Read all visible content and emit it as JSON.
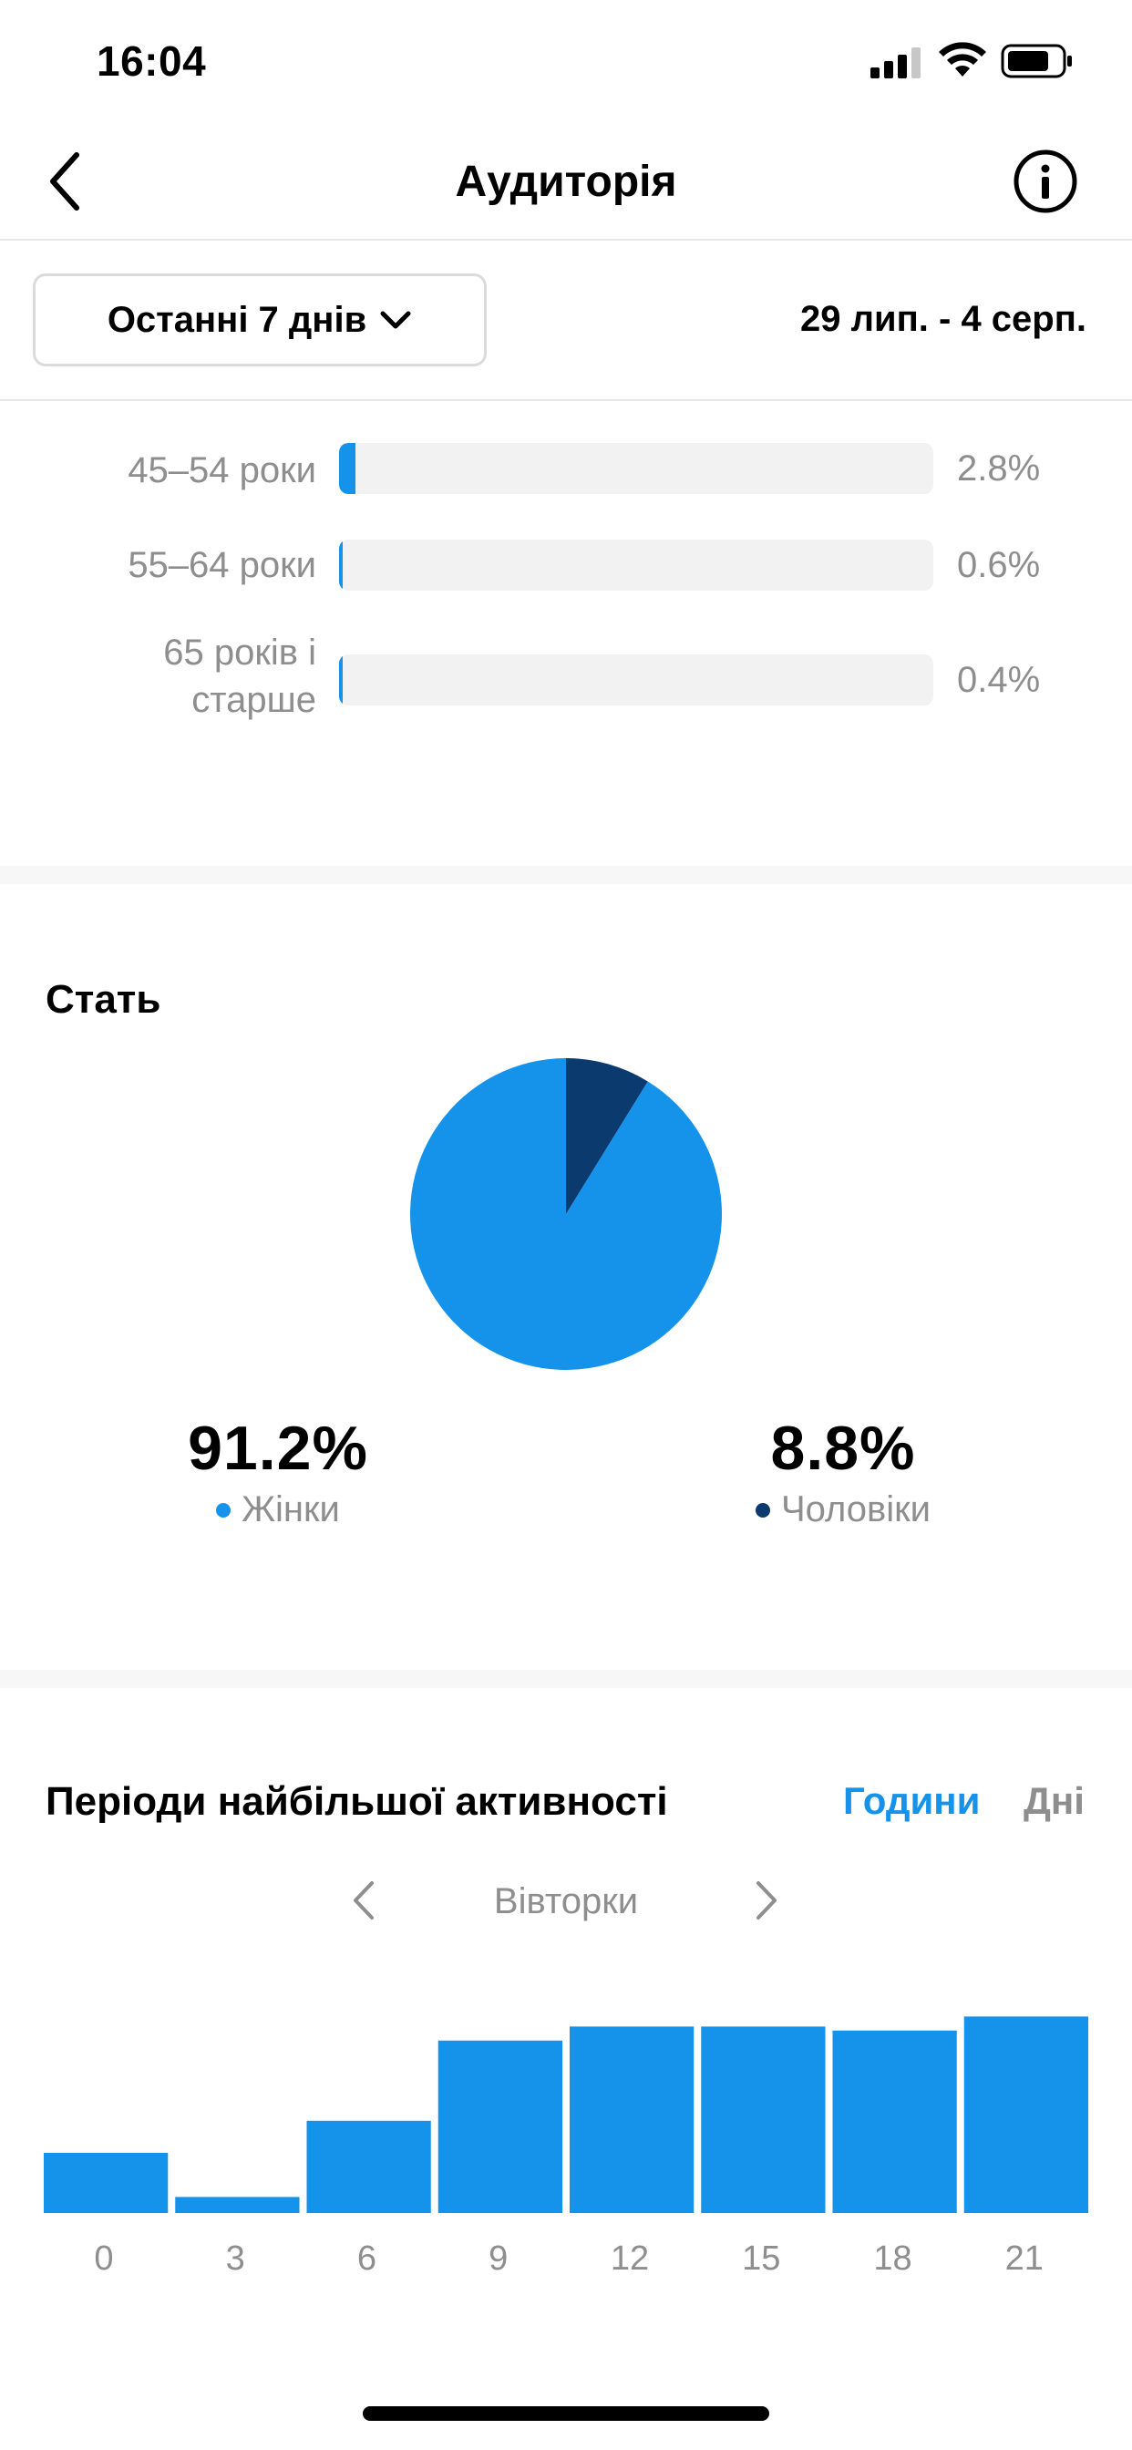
{
  "status_bar": {
    "time": "16:04"
  },
  "nav": {
    "title": "Аудиторія"
  },
  "filter": {
    "period_label": "Останні 7 днів",
    "date_range": "29 лип. - 4 серп."
  },
  "age": {
    "rows": [
      {
        "label": "45–54 роки",
        "value": "2.8%",
        "fraction": 0.028
      },
      {
        "label": "55–64 роки",
        "value": "0.6%",
        "fraction": 0.006
      },
      {
        "label": "65 років і старше",
        "value": "0.4%",
        "fraction": 0.004
      }
    ]
  },
  "gender": {
    "title": "Стать",
    "women": {
      "pct": "91.2%",
      "label": "Жінки",
      "color": "#1592ea"
    },
    "men": {
      "pct": "8.8%",
      "label": "Чоловіки",
      "color": "#0b3a6e"
    }
  },
  "activity": {
    "title": "Періоди найбільшої активності",
    "tab_hours": "Години",
    "tab_days": "Дні",
    "day_label": "Вівторки"
  },
  "chart_data": [
    {
      "type": "pie",
      "title": "Стать",
      "categories": [
        "Жінки",
        "Чоловіки"
      ],
      "values": [
        91.2,
        8.8
      ],
      "colors": [
        "#1592ea",
        "#0b3a6e"
      ]
    },
    {
      "type": "bar",
      "categories": [
        "0",
        "3",
        "6",
        "9",
        "12",
        "15",
        "18",
        "21"
      ],
      "values": [
        30,
        8,
        46,
        86,
        93,
        93,
        91,
        98
      ],
      "ylim": [
        0,
        100
      ],
      "color": "#1592ea",
      "grid": false
    }
  ]
}
